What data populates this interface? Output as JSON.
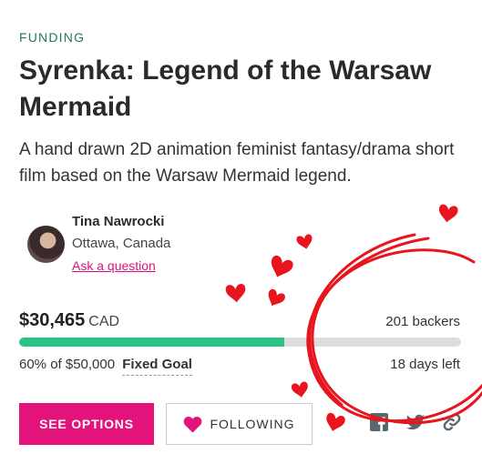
{
  "project": {
    "status": "FUNDING",
    "title": "Syrenka: Legend of the Warsaw Mermaid",
    "blurb": "A hand drawn 2D animation feminist fantasy/drama short film based on the Warsaw Mermaid legend."
  },
  "creator": {
    "name": "Tina Nawrocki",
    "location": "Ottawa, Canada",
    "ask_link": "Ask a question",
    "avatar_icon": "creator-avatar"
  },
  "stats": {
    "pledged": "$30,465",
    "currency": "CAD",
    "backers": "201 backers",
    "progress_fraction": 0.6,
    "goal_text": "60% of $50,000",
    "goal_type": "Fixed Goal",
    "days_left": "18 days left"
  },
  "actions": {
    "see_options": "SEE OPTIONS",
    "following": "FOLLOWING",
    "heart_icon": "heart-icon"
  },
  "share": {
    "icons": [
      "facebook-icon",
      "twitter-icon",
      "link-icon"
    ]
  },
  "colors": {
    "status": "#1f7a5b",
    "accent": "#e3137b",
    "progress": "#2cc486",
    "annotation": "#e8141e"
  }
}
